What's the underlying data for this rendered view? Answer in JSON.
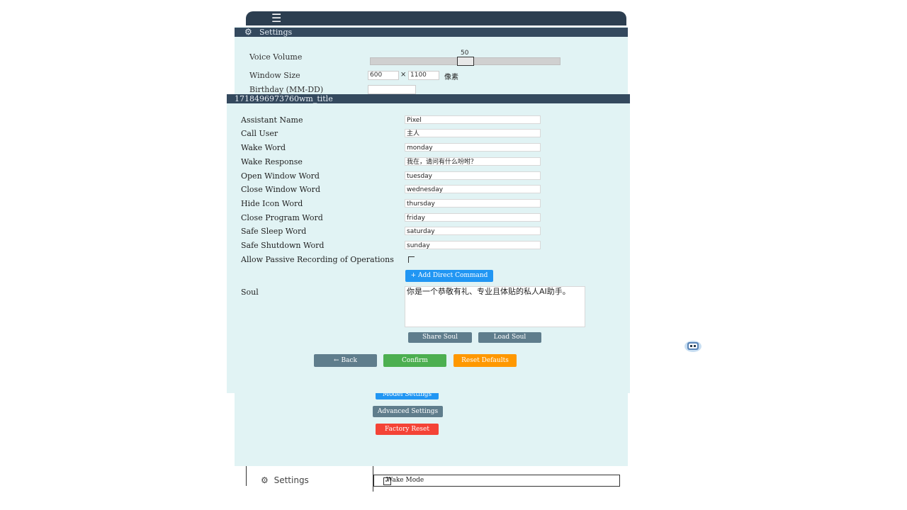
{
  "background_app": {
    "menu_icon": "hamburger-icon",
    "settings_header": "Settings",
    "voice_volume": {
      "label": "Voice Volume",
      "value": "50",
      "fraction": 0.5
    },
    "window_size": {
      "label": "Window Size",
      "width": "600",
      "separator": "×",
      "height": "1100",
      "unit": "像素"
    },
    "birthday": {
      "label": "Birthday (MM-DD)",
      "value": ""
    },
    "buttons": {
      "model_settings": "Model Settings",
      "advanced_settings": "Advanced Settings",
      "factory_reset": "Factory Reset"
    },
    "bottom_nav_label": "Settings",
    "wake_mode": {
      "label": "Wake Mode",
      "checked": true
    }
  },
  "dialog": {
    "title": "1718496973760wm_title",
    "fields": [
      {
        "label": "Assistant Name",
        "value": "Pixel"
      },
      {
        "label": "Call User",
        "value": "主人"
      },
      {
        "label": "Wake Word",
        "value": "monday"
      },
      {
        "label": "Wake Response",
        "value": "我在，请问有什么吩咐？"
      },
      {
        "label": "Open Window Word",
        "value": "tuesday"
      },
      {
        "label": "Close Window Word",
        "value": "wednesday"
      },
      {
        "label": "Hide Icon Word",
        "value": "thursday"
      },
      {
        "label": "Close Program Word",
        "value": "friday"
      },
      {
        "label": "Safe Sleep Word",
        "value": "saturday"
      },
      {
        "label": "Safe Shutdown Word",
        "value": "sunday"
      }
    ],
    "passive_recording": {
      "label": "Allow Passive Recording of Operations",
      "checked": false
    },
    "add_direct_command": "+ Add Direct Command",
    "soul": {
      "label": "Soul",
      "value": "你是一个恭敬有礼、专业且体贴的私人AI助手。"
    },
    "share_soul": "Share Soul",
    "load_soul": "Load Soul",
    "back": "← Back",
    "confirm": "Confirm",
    "reset_defaults": "Reset Defaults"
  },
  "colors": {
    "header_dark": "#34495e",
    "panel_bg": "#e1f3f4",
    "blue": "#2196f3",
    "slate": "#5f7d8c",
    "green": "#4caf50",
    "orange": "#ff9800",
    "red": "#f44336"
  },
  "floating_icon": "robot-icon"
}
